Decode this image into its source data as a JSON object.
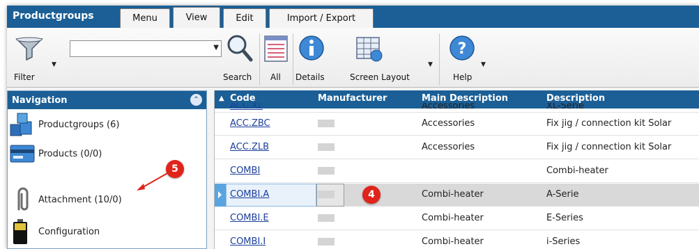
{
  "app": {
    "title": "Productgroups"
  },
  "tabs": [
    {
      "label": "Menu"
    },
    {
      "label": "View"
    },
    {
      "label": "Edit"
    },
    {
      "label": "Import / Export"
    }
  ],
  "toolbar": {
    "filter_label": "Filter",
    "combo_value": "",
    "search_label": "Search",
    "all_label": "All",
    "details_label": "Details",
    "screen_layout_label": "Screen Layout",
    "help_label": "Help"
  },
  "navigation": {
    "title": "Navigation",
    "items": [
      {
        "label": "Productgroups (6)",
        "icon": "cubes-icon"
      },
      {
        "label": "Products (0/0)",
        "icon": "card-icon"
      },
      {
        "label": "Attachment (10/0)",
        "icon": "paperclip-icon"
      },
      {
        "label": "Configuration",
        "icon": "battery-icon"
      }
    ]
  },
  "grid": {
    "columns": [
      "Code",
      "Manufacturer",
      "Main Description",
      "Description"
    ],
    "partial_row": {
      "code": "ACC.XL",
      "main": "Accessories",
      "desc": "XL-Serie"
    },
    "rows": [
      {
        "code": "ACC.ZBC",
        "main": "Accessories",
        "desc": "Fix jig / connection kit Solar"
      },
      {
        "code": "ACC.ZLB",
        "main": "Accessories",
        "desc": "Fix jig / connection kit Solar"
      },
      {
        "code": "COMBI",
        "main": "",
        "desc": "Combi-heater"
      },
      {
        "code": "COMBI.A",
        "main": "Combi-heater",
        "desc": "A-Serie"
      },
      {
        "code": "COMBI.E",
        "main": "Combi-heater",
        "desc": "E-Series"
      },
      {
        "code": "COMBI.I",
        "main": "Combi-heater",
        "desc": "i-Series"
      }
    ]
  },
  "callouts": {
    "five": "5",
    "four": "4"
  },
  "colors": {
    "header_blue": "#1b5f96",
    "callout_red": "#e0241b",
    "link_blue": "#1a3e9c"
  }
}
